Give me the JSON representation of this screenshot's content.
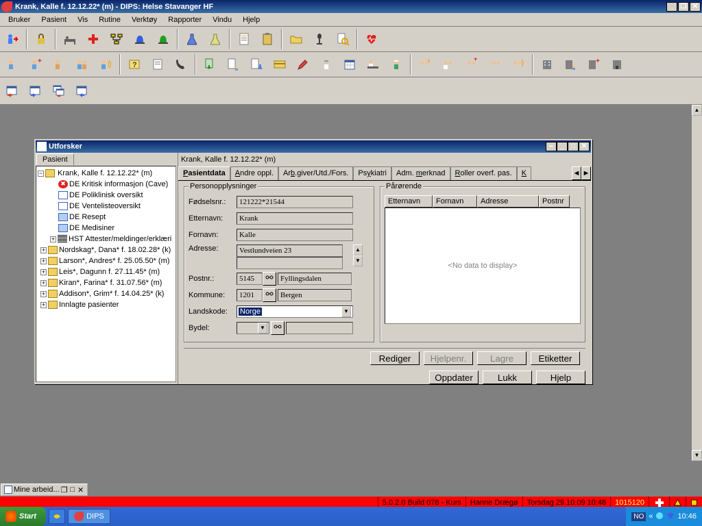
{
  "window": {
    "title": "Krank, Kalle f. 12.12.22* (m) - DIPS: Helse Stavanger HF"
  },
  "menubar": [
    "Bruker",
    "Pasient",
    "Vis",
    "Rutine",
    "Verktøy",
    "Rapporter",
    "Vindu",
    "Hjelp"
  ],
  "subwindow": {
    "title": "Utforsker",
    "left_tab": "Pasient",
    "patient_header": "Krank, Kalle f. 12.12.22* (m)"
  },
  "tree": {
    "root": "Krank, Kalle f. 12.12.22* (m)",
    "children": [
      "DE Kritisk informasjon (Cave)",
      "DE Poliklinisk oversikt",
      "DE Ventelisteoversikt",
      "DE Resept",
      "DE Medisiner",
      "HST Attester/meldinger/erklæri"
    ],
    "siblings": [
      "Nordskag*, Dana* f. 18.02.28* (k)",
      "Larson*, Andres* f. 25.05.50* (m)",
      "Leis*, Dagunn f. 27.11.45* (m)",
      "Kiran*, Farina* f. 31.07.56* (m)",
      "Addison*, Grim* f. 14.04.25* (k)",
      "Innlagte pasienter"
    ]
  },
  "tabs": [
    "Pasientdata",
    "Andre oppl.",
    "Arb.giver/Utd./Fors.",
    "Psykiatri",
    "Adm. merknad",
    "Roller overf. pas.",
    "K"
  ],
  "form": {
    "group1_title": "Personopplysninger",
    "fodselsnr_label": "Fødselsnr.:",
    "fodselsnr": "121222*21544",
    "etternavn_label": "Etternavn:",
    "etternavn": "Krank",
    "fornavn_label": "Fornavn:",
    "fornavn": "Kalle",
    "adresse_label": "Adresse:",
    "adresse": "Vestlundveien 23",
    "postnr_label": "Postnr.:",
    "postnr": "5145",
    "poststed": "Fyllingsdalen",
    "kommune_label": "Kommune:",
    "kommune_nr": "1201",
    "kommune": "Bergen",
    "landskode_label": "Landskode:",
    "landskode": "Norge",
    "bydel_label": "Bydel:",
    "bydel": ""
  },
  "parorende": {
    "title": "Pårørende",
    "cols": [
      "Etternavn",
      "Fornavn",
      "Adresse",
      "Postnr"
    ],
    "empty": "<No data to display>"
  },
  "buttons": {
    "rediger": "Rediger",
    "hjelpenr": "Hjelpenr.",
    "lagre": "Lagre",
    "etiketter": "Etiketter",
    "oppdater": "Oppdater",
    "lukk": "Lukk",
    "hjelp": "Hjelp"
  },
  "minimized": "Mine arbeid...",
  "statusbar": {
    "build": "5.0.2.0 Build 078 - Kurs",
    "user": "Hanne Drægø",
    "date": "Torsdag 29.10.09 10:46",
    "code": "1015120"
  },
  "taskbar": {
    "start": "Start",
    "app": "DIPS",
    "lang": "NO",
    "clock": "10:46"
  }
}
